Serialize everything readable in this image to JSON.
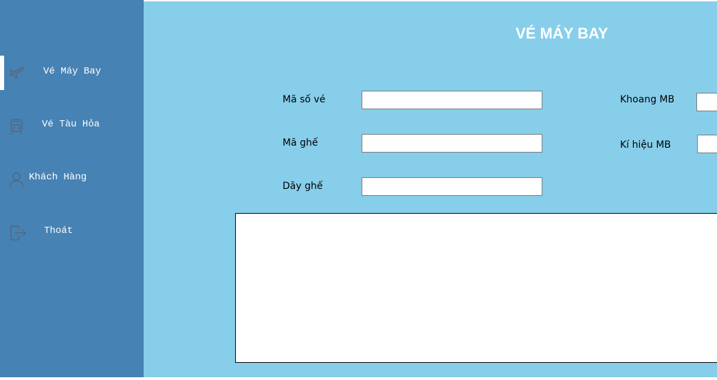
{
  "sidebar": {
    "items": [
      {
        "label": "Vé Máy Bay",
        "icon": "airplane-icon",
        "active": true
      },
      {
        "label": "Vé Tàu Hỏa",
        "icon": "train-icon",
        "active": false
      },
      {
        "label": "Khách Hàng",
        "icon": "user-icon",
        "active": false
      },
      {
        "label": "Thoát",
        "icon": "exit-icon",
        "active": false
      }
    ]
  },
  "main": {
    "title": "VÉ MÁY BAY",
    "fields": {
      "ticket_id": {
        "label": "Mã số vé",
        "value": ""
      },
      "seat_id": {
        "label": "Mã ghế",
        "value": ""
      },
      "seat_row": {
        "label": "Dãy ghế",
        "value": ""
      },
      "cabin": {
        "label": "Khoang MB",
        "value": ""
      },
      "aircraft_code": {
        "label": "Kí hiệu MB",
        "value": ""
      }
    }
  },
  "colors": {
    "sidebar": "#4682b4",
    "main": "#87ceeb",
    "title": "#ffffff",
    "icon": "#5a6478"
  }
}
